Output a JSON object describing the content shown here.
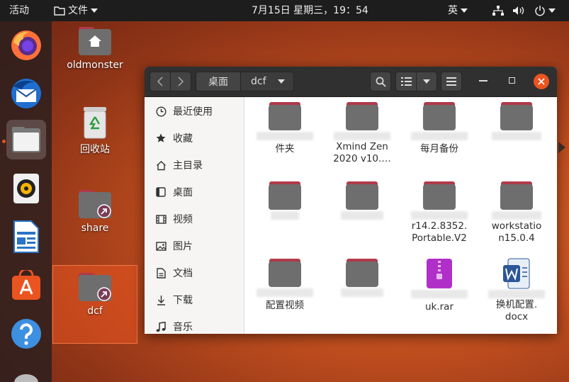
{
  "topbar": {
    "activities": "活动",
    "app_menu": "文件",
    "clock": "7月15日 星期三，19：54",
    "input_method": "英"
  },
  "desktop": {
    "icons": [
      {
        "label": "oldmonster"
      },
      {
        "label": "回收站"
      },
      {
        "label": "share"
      },
      {
        "label": "dcf"
      }
    ]
  },
  "window": {
    "breadcrumb": [
      "桌面",
      "dcf"
    ],
    "sidebar": [
      {
        "label": "最近使用",
        "icon": "clock-icon"
      },
      {
        "label": "收藏",
        "icon": "star-icon"
      },
      {
        "label": "主目录",
        "icon": "home-icon"
      },
      {
        "label": "桌面",
        "icon": "desktop-icon"
      },
      {
        "label": "视频",
        "icon": "film-icon"
      },
      {
        "label": "图片",
        "icon": "image-icon"
      },
      {
        "label": "文档",
        "icon": "document-icon"
      },
      {
        "label": "下载",
        "icon": "download-icon"
      },
      {
        "label": "音乐",
        "icon": "music-icon"
      }
    ],
    "files": [
      {
        "line1": "件夹",
        "line2": ""
      },
      {
        "line1": "Xmind Zen",
        "line2": "2020 v10.…"
      },
      {
        "line1": "每月备份",
        "line2": ""
      },
      {
        "line1": "",
        "line2": ""
      },
      {
        "line1": "",
        "line2": ""
      },
      {
        "line1": "",
        "line2": ""
      },
      {
        "line1": "r14.2.8352.",
        "line2": "Portable.V2"
      },
      {
        "line1": "workstatio",
        "line2": "n15.0.4"
      },
      {
        "line1": "配置视频",
        "line2": ""
      },
      {
        "line1": "",
        "line2": ""
      },
      {
        "line1": "uk.rar",
        "line2": ""
      },
      {
        "line1": "换机配置.",
        "line2": "docx"
      }
    ]
  },
  "colors": {
    "accent": "#e95420",
    "folder": "#6e6e6e",
    "folder_tab": "#b03a4a"
  }
}
